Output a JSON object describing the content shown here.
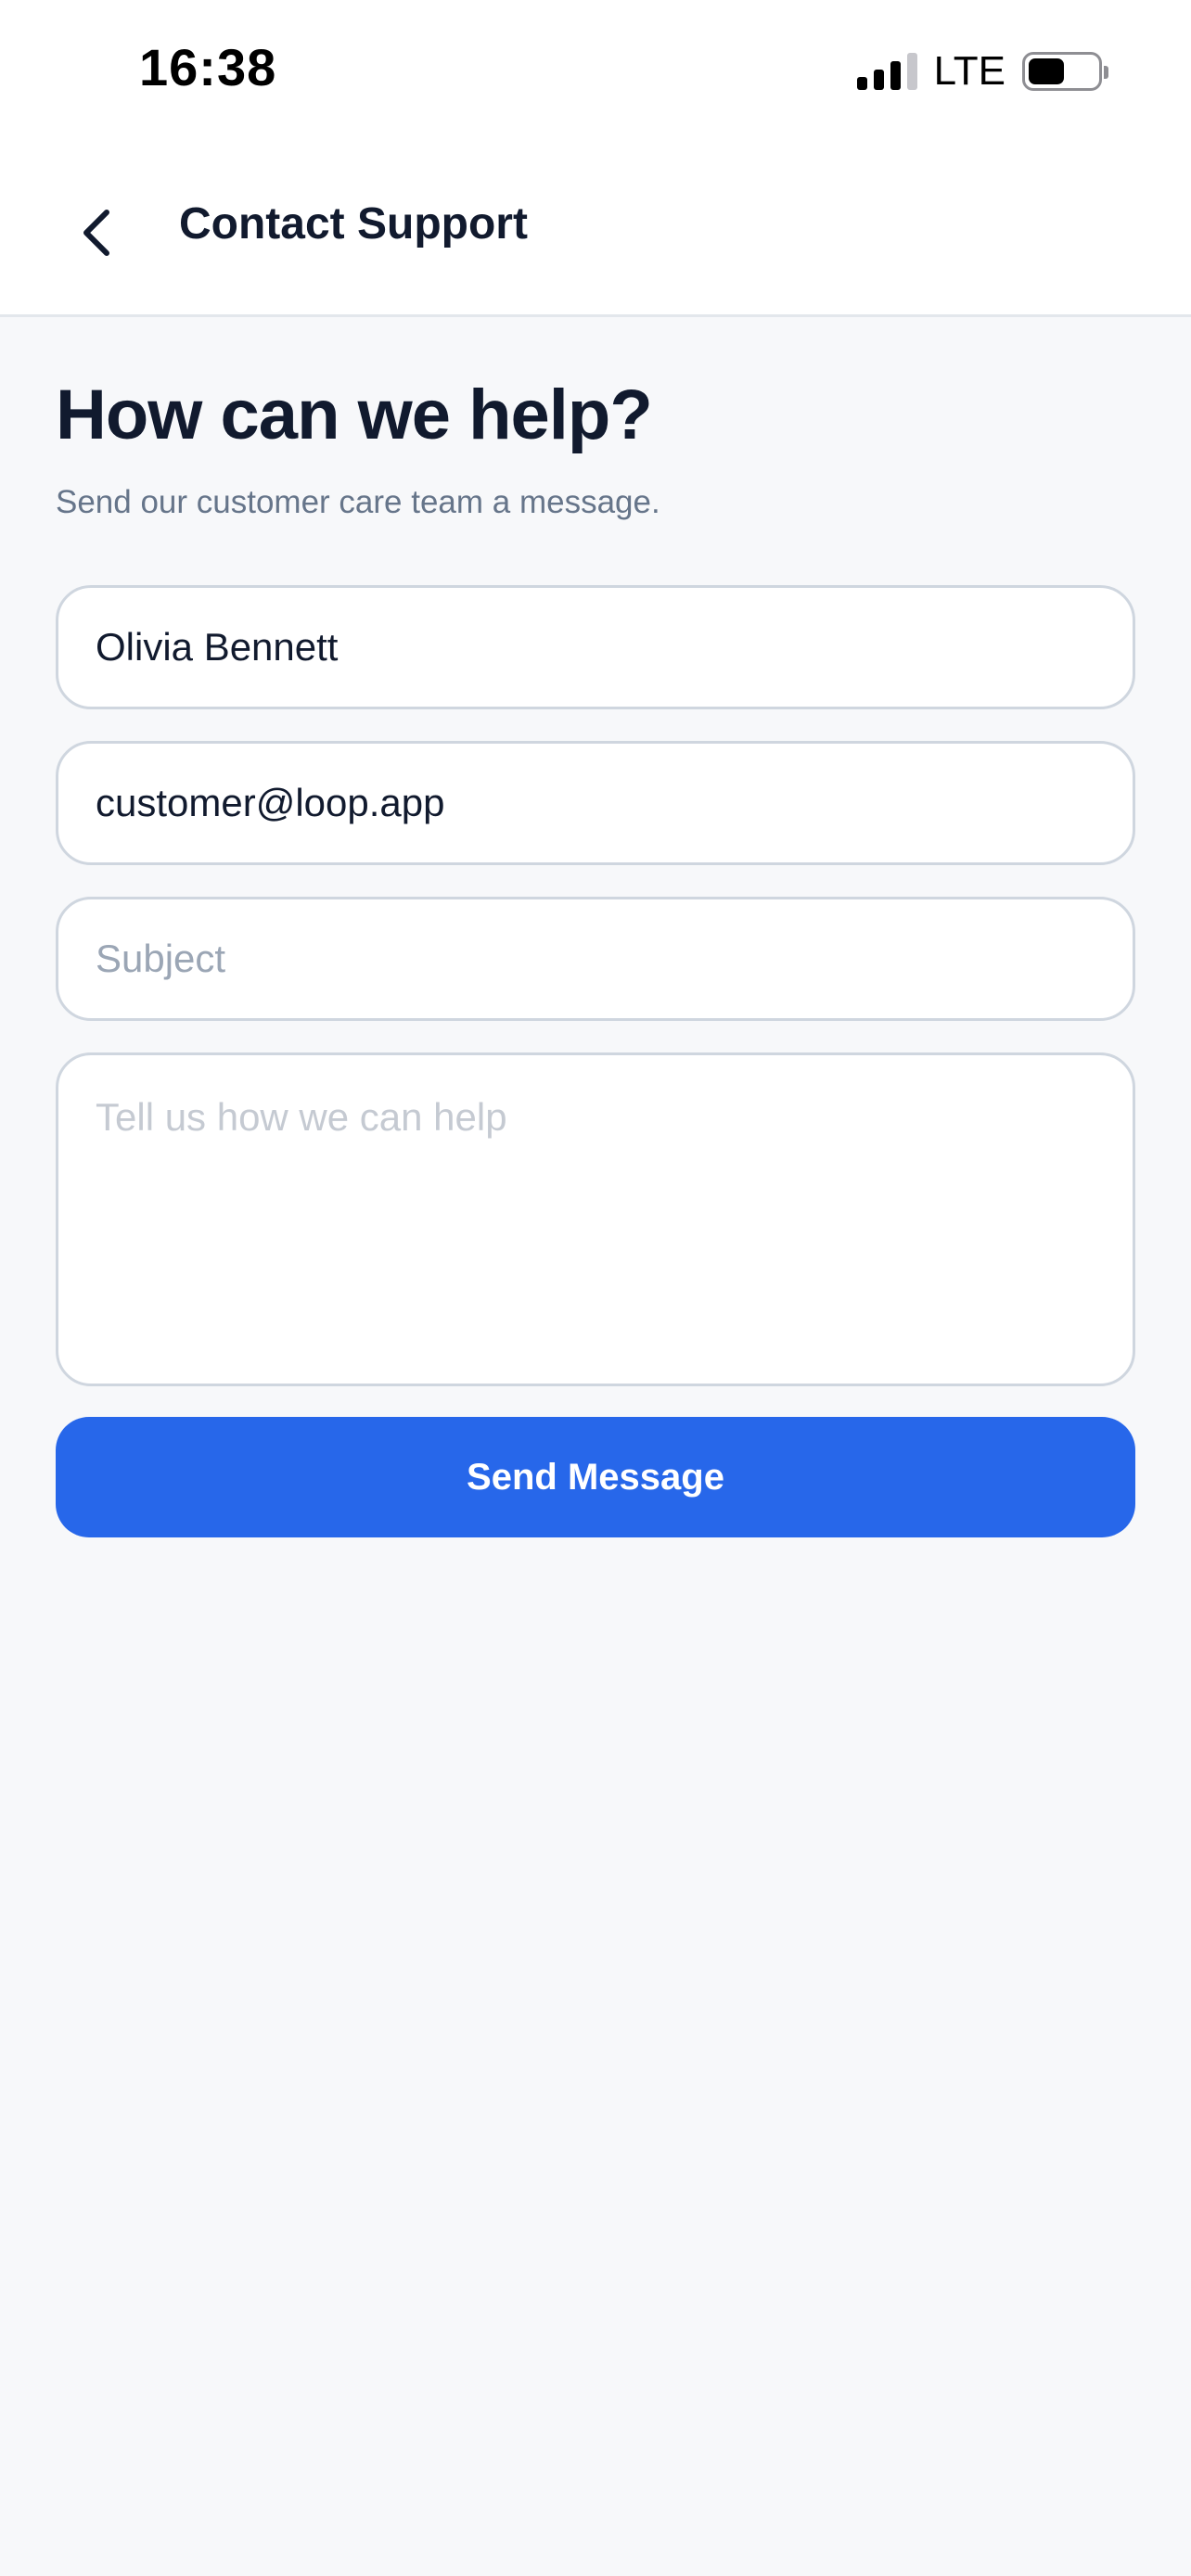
{
  "status_bar": {
    "time": "16:38",
    "network": "LTE",
    "icons": [
      "signal-icon",
      "battery-icon"
    ]
  },
  "header": {
    "title": "Contact Support",
    "back_icon": "chevron-left-icon"
  },
  "hero": {
    "title": "How can we help?",
    "subtitle": "Send our customer care team a message."
  },
  "form": {
    "name": {
      "value": "Olivia Bennett",
      "placeholder": ""
    },
    "email": {
      "value": "customer@loop.app",
      "placeholder": ""
    },
    "subject": {
      "value": "",
      "placeholder": "Subject"
    },
    "message": {
      "value": "",
      "placeholder": "Tell us how we can help"
    },
    "submit_label": "Send Message"
  },
  "colors": {
    "accent": "#2767ea",
    "title": "#111a2e",
    "subtitle": "#66758a",
    "background": "#f7f8fa",
    "field_border": "#cfd6df"
  }
}
